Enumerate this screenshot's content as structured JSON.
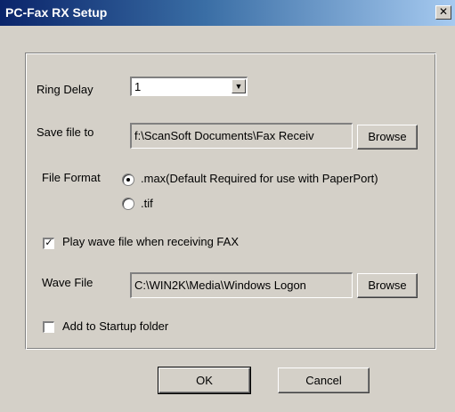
{
  "window": {
    "title": "PC-Fax RX Setup",
    "close_glyph": "✕"
  },
  "ring_delay": {
    "label": "Ring Delay",
    "value": "1"
  },
  "save_file": {
    "label": "Save file to",
    "value": "f:\\ScanSoft Documents\\Fax Receiv",
    "browse_label": "Browse"
  },
  "file_format": {
    "label": "File Format",
    "options": [
      {
        "label": ".max(Default Required for use with PaperPort)",
        "selected": true
      },
      {
        "label": ".tif",
        "selected": false
      }
    ]
  },
  "play_wave": {
    "label": "Play wave file when receiving FAX",
    "checked": true
  },
  "wave_file": {
    "label": "Wave File",
    "value": "C:\\WIN2K\\Media\\Windows Logon",
    "browse_label": "Browse"
  },
  "startup": {
    "label": "Add to Startup folder",
    "checked": false
  },
  "buttons": {
    "ok": "OK",
    "cancel": "Cancel"
  },
  "colors": {
    "face": "#d4d0c8",
    "title_start": "#0a246a",
    "title_end": "#a6caf0"
  }
}
